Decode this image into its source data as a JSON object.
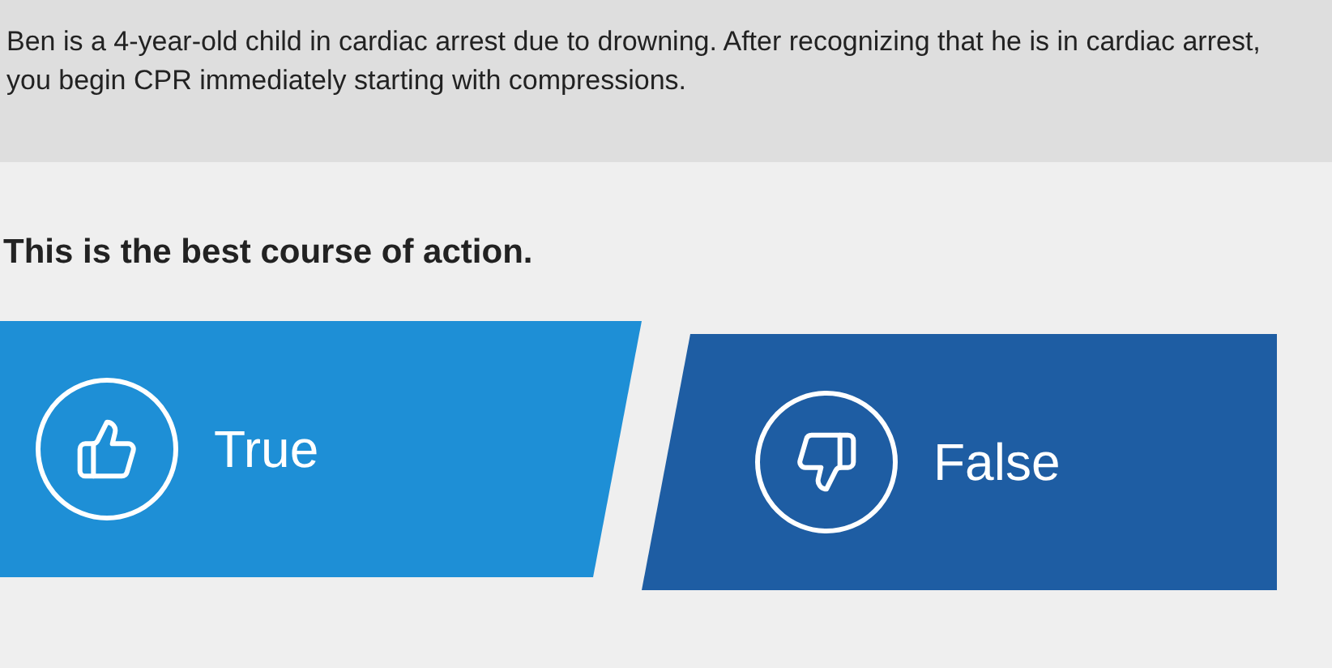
{
  "scenario": "Ben is a 4-year-old child in cardiac arrest due to drowning. After recognizing that he is in cardiac arrest, you begin CPR immediately starting with compressions.",
  "question": "This is the best course of action.",
  "answers": [
    {
      "label": "True",
      "kind": "agree"
    },
    {
      "label": "False",
      "kind": "disagree"
    }
  ]
}
